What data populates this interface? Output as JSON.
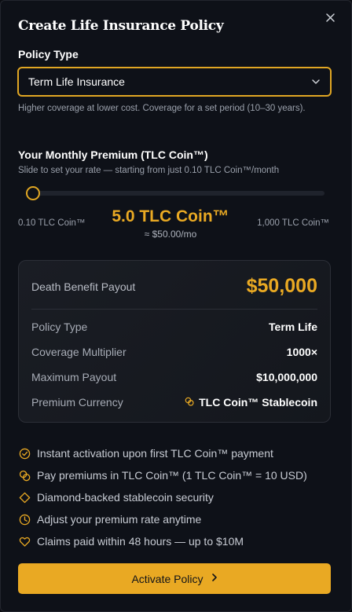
{
  "modal": {
    "title": "Create Life Insurance Policy",
    "close_icon": "close-icon"
  },
  "policy_type": {
    "label": "Policy Type",
    "selected": "Term Life Insurance",
    "helper": "Higher coverage at lower cost. Coverage for a set period (10–30 years)."
  },
  "premium": {
    "label": "Your Monthly Premium (TLC Coin™)",
    "sub": "Slide to set your rate — starting from just 0.10 TLC Coin™/month",
    "min_label": "0.10 TLC Coin™",
    "max_label": "1,000 TLC Coin™",
    "value_label": "5.0 TLC Coin™",
    "usd_label": "≈ $50.00/mo",
    "slider_fraction": 0.005
  },
  "summary": {
    "head_label": "Death Benefit Payout",
    "head_value": "$50,000",
    "rows": [
      {
        "k": "Policy Type",
        "v": "Term Life"
      },
      {
        "k": "Coverage Multiplier",
        "v": "1000×"
      },
      {
        "k": "Maximum Payout",
        "v": "$10,000,000"
      },
      {
        "k": "Premium Currency",
        "v": "TLC Coin™ Stablecoin",
        "icon": "coins-icon"
      }
    ]
  },
  "features": [
    {
      "icon": "check-circle-icon",
      "text": "Instant activation upon first TLC Coin™ payment"
    },
    {
      "icon": "coins-icon",
      "text": "Pay premiums in TLC Coin™ (1 TLC Coin™ = 10 USD)"
    },
    {
      "icon": "diamond-icon",
      "text": "Diamond-backed stablecoin security"
    },
    {
      "icon": "clock-icon",
      "text": "Adjust your premium rate anytime"
    },
    {
      "icon": "heart-icon",
      "text": "Claims paid within 48 hours — up to $10M"
    }
  ],
  "cta": {
    "label": "Activate Policy",
    "icon": "chevron-right-icon"
  },
  "colors": {
    "accent": "#e9a923",
    "background": "#0e1118",
    "card": "#1a1d24"
  }
}
